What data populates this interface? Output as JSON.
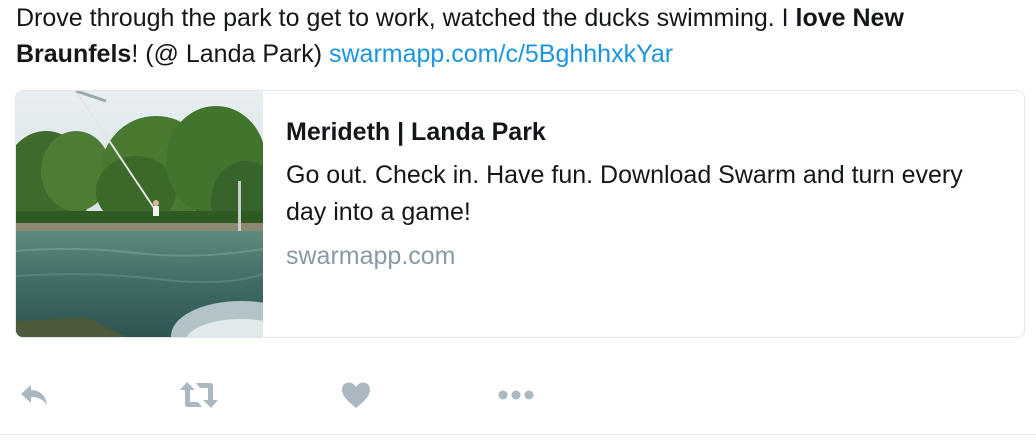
{
  "tweet": {
    "text_part1": "Drove through the park to get to work, watched the ducks swimming. I ",
    "text_bold1": "love New Braunfels",
    "text_part2": "! (@ Landa Park) ",
    "link": "swarmapp.com/c/5BghhhxkYar"
  },
  "card": {
    "image_alt": "Landa Park pool photo",
    "title": "Merideth | Landa Park",
    "description": "Go out. Check in. Have fun. Download Swarm and turn every day into a game!",
    "domain": "swarmapp.com"
  },
  "actions": {
    "reply_icon": "reply-icon",
    "retweet_icon": "retweet-icon",
    "like_icon": "heart-icon",
    "more_icon": "more-icon",
    "icon_color": "#aab8c2"
  }
}
